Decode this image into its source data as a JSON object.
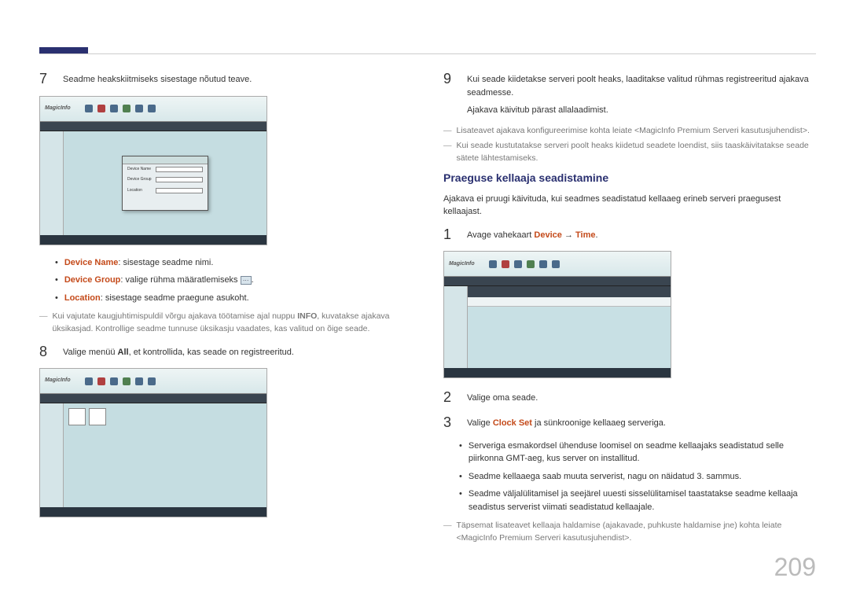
{
  "pageNumber": "209",
  "left": {
    "step7": {
      "num": "7",
      "text": "Seadme heakskiitmiseks sisestage nõutud teave.",
      "shot_logo": "MagicInfo",
      "dlg": {
        "r1": "Device Name",
        "r2": "Device Group",
        "r3": "Location"
      }
    },
    "bullets": [
      {
        "label": "Device Name",
        "text": ": sisestage seadme nimi."
      },
      {
        "label": "Device Group",
        "text": ": valige rühma määratlemiseks "
      },
      {
        "label": "Location",
        "text": ": sisestage seadme praegune asukoht."
      }
    ],
    "note1a": "Kui vajutate kaugjuhtimispuldil võrgu ajakava töötamise ajal nuppu ",
    "note1b": "INFO",
    "note1c": ", kuvatakse ajakava üksikasjad. Kontrollige seadme tunnuse üksikasju vaadates, kas valitud on õige seade.",
    "step8": {
      "num": "8",
      "t1": "Valige menüü ",
      "t2": "All",
      "t3": ", et kontrollida, kas seade on registreeritud."
    }
  },
  "right": {
    "step9": {
      "num": "9",
      "l1": "Kui seade kiidetakse serveri poolt heaks, laaditakse valitud rühmas registreeritud ajakava seadmesse.",
      "l2": "Ajakava käivitub pärast allalaadimist."
    },
    "note_a": "Lisateavet ajakava konfigureerimise kohta leiate <MagicInfo Premium Serveri kasutusjuhendist>.",
    "note_b": "Kui seade kustutatakse serveri poolt heaks kiidetud seadete loendist, siis taaskäivitatakse seade sätete lähtestamiseks.",
    "subhead": "Praeguse kellaaja seadistamine",
    "subpara": "Ajakava ei pruugi käivituda, kui seadmes seadistatud kellaaeg erineb serveri praegusest kellaajast.",
    "step1": {
      "num": "1",
      "t1": "Avage vahekaart ",
      "t2": "Device",
      "t3": " → ",
      "t4": "Time",
      "t5": "."
    },
    "step2": {
      "num": "2",
      "text": "Valige oma seade."
    },
    "step3": {
      "num": "3",
      "t1": "Valige ",
      "t2": "Clock Set",
      "t3": " ja sünkroonige kellaaeg serveriga."
    },
    "bullets2": [
      "Serveriga esmakordsel ühenduse loomisel on seadme kellaajaks seadistatud selle piirkonna GMT-aeg, kus server on installitud.",
      "Seadme kellaaega saab muuta serverist, nagu on näidatud 3. sammus.",
      "Seadme väljalülitamisel ja seejärel uuesti sisselülitamisel taastatakse seadme kellaaja seadistus serverist viimati seadistatud kellaajale."
    ],
    "note_c": "Täpsemat lisateavet kellaaja haldamise (ajakavade, puhkuste haldamise jne) kohta leiate <MagicInfo Premium Serveri kasutusjuhendist>."
  }
}
